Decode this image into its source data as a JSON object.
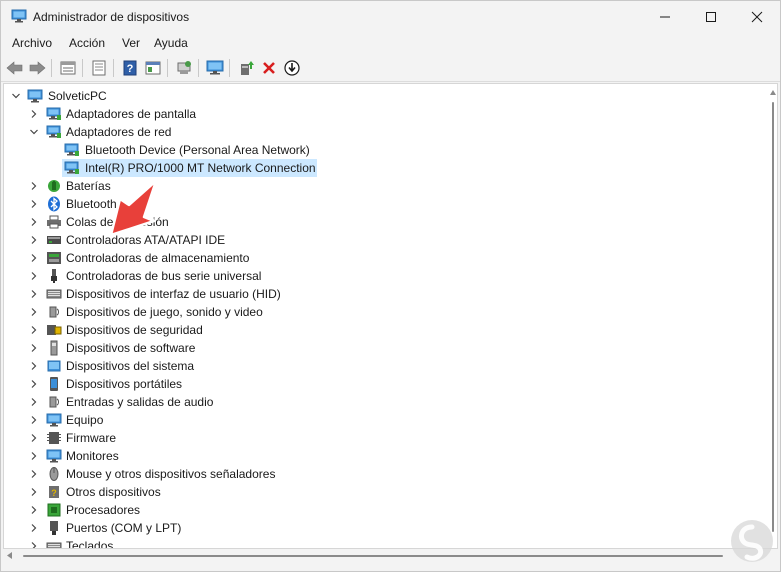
{
  "window": {
    "title": "Administrador de dispositivos",
    "controls": [
      "minimize",
      "maximize",
      "close"
    ]
  },
  "menu": {
    "items": [
      "Archivo",
      "Acción",
      "Ver",
      "Ayuda"
    ]
  },
  "toolbar": {
    "buttons": [
      "back-icon",
      "forward-icon",
      "properties-grid-icon",
      "properties-icon",
      "help-icon",
      "view-icon",
      "scan-icon",
      "monitor-icon",
      "update-driver-icon",
      "uninstall-icon",
      "disable-icon"
    ]
  },
  "tree": {
    "root": "SolveticPC",
    "selected_item": "Intel(R) PRO/1000 MT Network Connection",
    "items": [
      {
        "label": "Adaptadores de pantalla",
        "icon": "display-adapter-icon",
        "expanded": false
      },
      {
        "label": "Adaptadores de red",
        "icon": "network-adapter-icon",
        "expanded": true
      },
      {
        "label": "Bluetooth Device (Personal Area Network)",
        "icon": "network-adapter-icon",
        "child": true
      },
      {
        "label": "Intel(R) PRO/1000 MT Network Connection",
        "icon": "network-adapter-icon",
        "child": true,
        "selected": true
      },
      {
        "label": "Baterías",
        "icon": "battery-icon",
        "expanded": false
      },
      {
        "label": "Bluetooth",
        "icon": "bluetooth-icon",
        "expanded": false
      },
      {
        "label": "Colas de impresión",
        "icon": "printer-icon",
        "expanded": false
      },
      {
        "label": "Controladoras ATA/ATAPI IDE",
        "icon": "ide-controller-icon",
        "expanded": false
      },
      {
        "label": "Controladoras de almacenamiento",
        "icon": "storage-controller-icon",
        "expanded": false
      },
      {
        "label": "Controladoras de bus serie universal",
        "icon": "usb-icon",
        "expanded": false
      },
      {
        "label": "Dispositivos de interfaz de usuario (HID)",
        "icon": "hid-icon",
        "expanded": false
      },
      {
        "label": "Dispositivos de juego, sonido y video",
        "icon": "sound-icon",
        "expanded": false
      },
      {
        "label": "Dispositivos de seguridad",
        "icon": "security-icon",
        "expanded": false
      },
      {
        "label": "Dispositivos de software",
        "icon": "software-device-icon",
        "expanded": false
      },
      {
        "label": "Dispositivos del sistema",
        "icon": "system-device-icon",
        "expanded": false
      },
      {
        "label": "Dispositivos portátiles",
        "icon": "portable-device-icon",
        "expanded": false
      },
      {
        "label": "Entradas y salidas de audio",
        "icon": "audio-io-icon",
        "expanded": false
      },
      {
        "label": "Equipo",
        "icon": "computer-icon",
        "expanded": false
      },
      {
        "label": "Firmware",
        "icon": "firmware-icon",
        "expanded": false
      },
      {
        "label": "Monitores",
        "icon": "monitor-icon",
        "expanded": false
      },
      {
        "label": "Mouse y otros dispositivos señaladores",
        "icon": "mouse-icon",
        "expanded": false
      },
      {
        "label": "Otros dispositivos",
        "icon": "other-device-icon",
        "expanded": false
      },
      {
        "label": "Procesadores",
        "icon": "processor-icon",
        "expanded": false
      },
      {
        "label": "Puertos (COM y LPT)",
        "icon": "port-icon",
        "expanded": false
      },
      {
        "label": "Teclados",
        "icon": "keyboard-icon",
        "expanded": false
      }
    ]
  },
  "colors": {
    "selection": "#cce8ff",
    "accent_arrow": "#e8403a",
    "window_bg": "#f3f3f3",
    "panel_bg": "#ffffff"
  }
}
